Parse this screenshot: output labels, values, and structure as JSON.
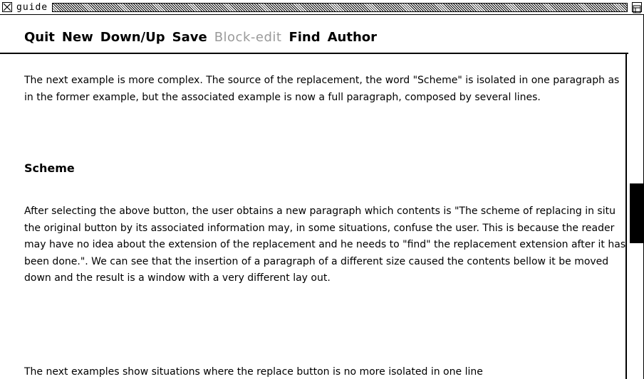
{
  "window": {
    "title": "guide"
  },
  "menu": {
    "items": [
      {
        "label": "Quit",
        "enabled": true
      },
      {
        "label": "New",
        "enabled": true
      },
      {
        "label": "Down/Up",
        "enabled": true
      },
      {
        "label": "Save",
        "enabled": true
      },
      {
        "label": "Block-edit",
        "enabled": false
      },
      {
        "label": "Find",
        "enabled": true
      },
      {
        "label": "Author",
        "enabled": true
      }
    ]
  },
  "document": {
    "para1": "The next example is more complex. The source of the replacement, the word \"Scheme\" is isolated in one paragraph as in the former example, but the associated example is now a full paragraph, composed by several lines.",
    "heading": "Scheme",
    "para2": "After selecting the above button, the user obtains a new paragraph which contents  is \"The scheme of replacing in situ the original button by its associated information may, in some situations, confuse the user. This is because the reader may have no idea about the extension of the replacement and he needs to \"find\" the replacement extension after it has been done.\". We can see that the insertion of a paragraph of a different size caused the contents bellow it be moved down and the result is a window with a very different lay out.",
    "para3": "The next examples show situations where the replace button is no more isolated in one line"
  },
  "scrollbar": {
    "position_fraction": 0.4
  }
}
